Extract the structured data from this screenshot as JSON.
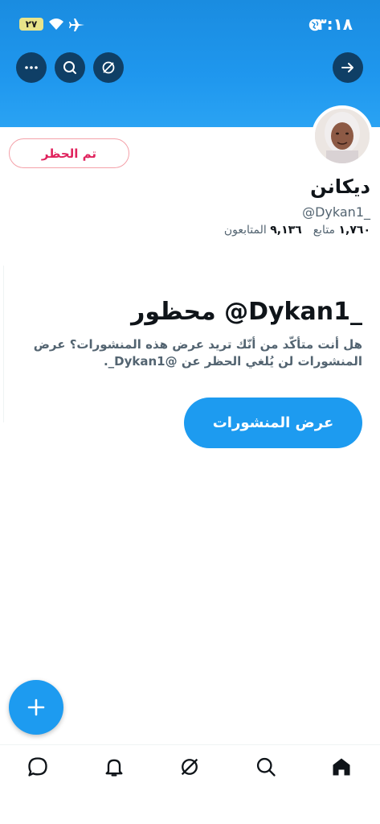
{
  "status_bar": {
    "time": "٣:١٨",
    "battery": "٢٧"
  },
  "profile": {
    "name": "ديكانن",
    "handle": "@Dykan1_",
    "following_count": "١,٧٦٠",
    "following_label": "متابع",
    "followers_count": "٩,١٣٦",
    "followers_label": "المتابعون",
    "blocked_button": "تم الحظر"
  },
  "blocked_notice": {
    "title": "محظور @Dykan1_",
    "message": "هل أنت متأكّد من أنّك تريد عرض هذه المنشورات؟ عرض المنشورات لن يُلغي الحظر عن @Dykan1_.",
    "button": "عرض المنشورات"
  },
  "colors": {
    "accent": "#1d9bf0",
    "blocked": "#e0245e",
    "header_button": "#0f3f66"
  },
  "icons": {
    "back": "arrow-right-icon",
    "grok": "grok-icon",
    "search": "search-icon",
    "more": "more-icon",
    "compose": "plus-icon",
    "nav": [
      "home-icon",
      "search-icon",
      "grok-icon",
      "notifications-icon",
      "messages-icon"
    ]
  }
}
